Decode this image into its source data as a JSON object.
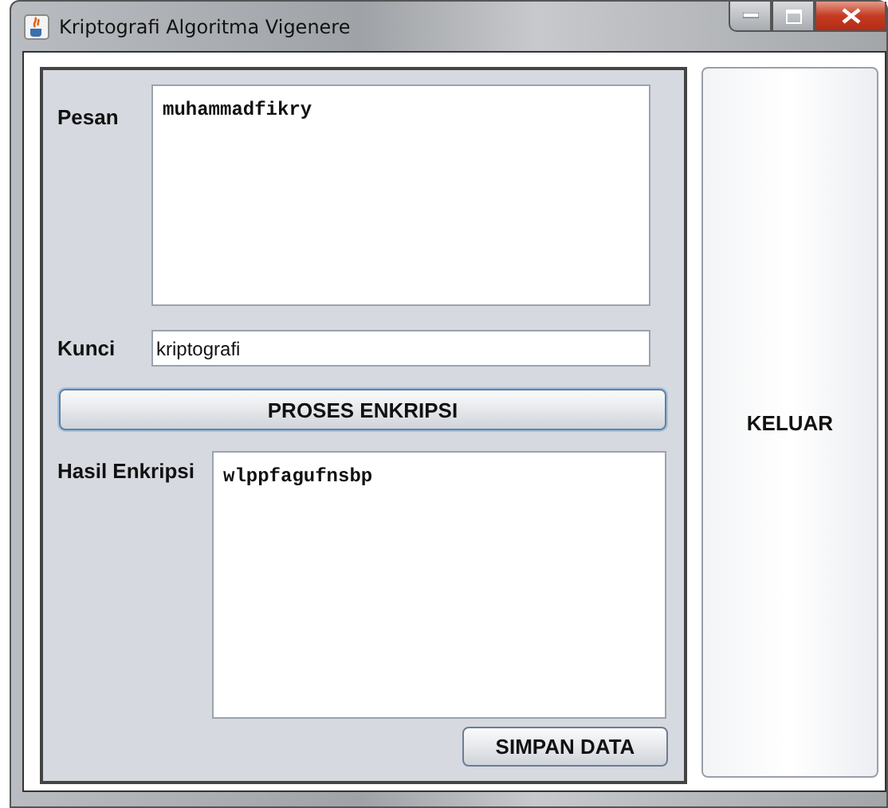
{
  "window": {
    "title": "Kriptografi Algoritma Vigenere"
  },
  "pesan": {
    "label": "Pesan",
    "value": "muhammadfikry"
  },
  "kunci": {
    "label": "Kunci",
    "value": "kriptografi"
  },
  "encrypt_button": "PROSES ENKRIPSI",
  "hasil": {
    "label": "Hasil Enkripsi",
    "value": "wlppfagufnsbp"
  },
  "save_button": "SIMPAN DATA",
  "exit_button": "KELUAR"
}
